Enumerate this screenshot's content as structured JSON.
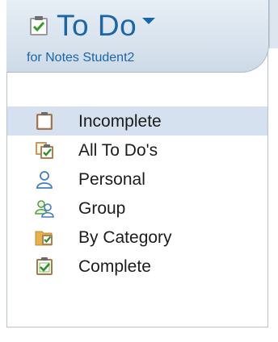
{
  "header": {
    "title": "To Do",
    "subtitle": "for Notes Student2",
    "title_icon": "todo-clipboard-check-icon",
    "menu_icon": "chevron-down-icon"
  },
  "nav": {
    "items": [
      {
        "label": "Incomplete",
        "icon": "clipboard-icon",
        "selected": true
      },
      {
        "label": "All To Do's",
        "icon": "clipboard-stack-icon",
        "selected": false
      },
      {
        "label": "Personal",
        "icon": "person-icon",
        "selected": false
      },
      {
        "label": "Group",
        "icon": "group-icon",
        "selected": false
      },
      {
        "label": "By Category",
        "icon": "folder-category-icon",
        "selected": false
      },
      {
        "label": "Complete",
        "icon": "clipboard-check-icon",
        "selected": false
      }
    ]
  },
  "colors": {
    "accent": "#1a66a6",
    "selected_bg": "#d5e1ee",
    "header_bg": "#dde6ef"
  }
}
